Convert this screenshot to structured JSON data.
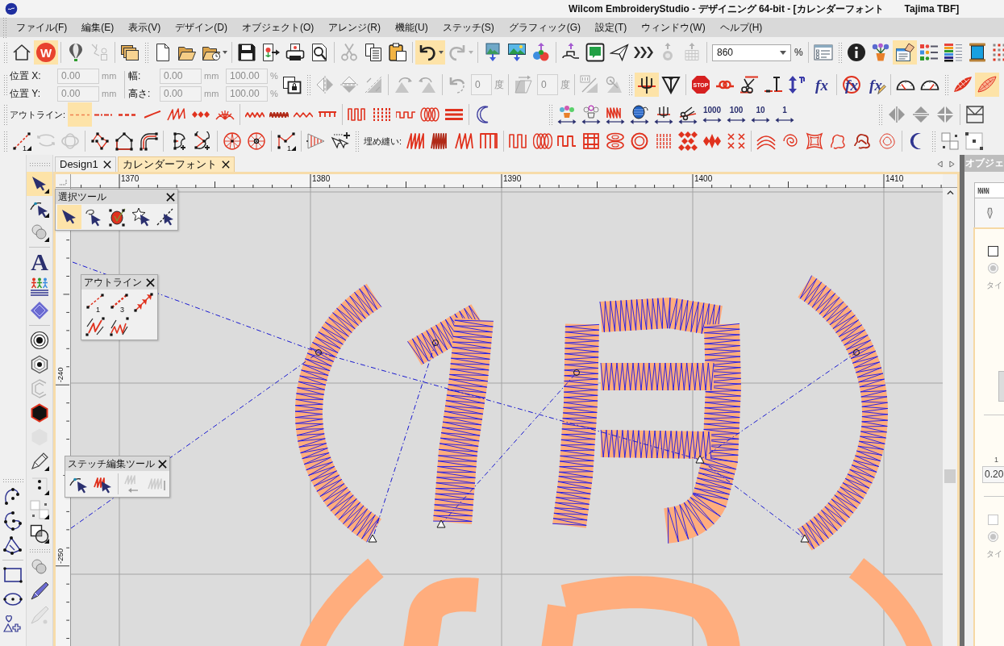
{
  "title_bar": {
    "title": "Wilcom EmbroideryStudio - デザイニング 64-bit - [カレンダーフォント",
    "format": "Tajima TBF]"
  },
  "menu_bar": [
    "ファイル(F)",
    "編集(E)",
    "表示(V)",
    "デザイン(D)",
    "オブジェクト(O)",
    "アレンジ(R)",
    "機能(U)",
    "ステッチ(S)",
    "グラフィック(G)",
    "設定(T)",
    "ウィンドウ(W)",
    "ヘルプ(H)"
  ],
  "standard_toolbar": {
    "buttons": [
      {
        "selected": false,
        "disabled": false
      },
      {
        "selected": true,
        "disabled": false,
        "label": "W"
      },
      {
        "selected": false,
        "disabled": false
      },
      {
        "selected": false,
        "disabled": true
      },
      {
        "selected": false,
        "disabled": false
      },
      {
        "selected": false,
        "disabled": false
      },
      {
        "selected": false,
        "disabled": false
      },
      {
        "selected": false,
        "disabled": false
      },
      {
        "selected": false,
        "disabled": false
      },
      {
        "selected": false,
        "disabled": false
      },
      {
        "selected": false,
        "disabled": false
      },
      {
        "selected": false,
        "disabled": false
      },
      {
        "selected": false,
        "disabled": true
      },
      {
        "selected": false,
        "disabled": false
      },
      {
        "selected": false,
        "disabled": false
      },
      {
        "selected": true,
        "disabled": false
      },
      {
        "selected": false,
        "disabled": true
      },
      {
        "selected": false,
        "disabled": false
      },
      {
        "selected": false,
        "disabled": false
      },
      {
        "selected": false,
        "disabled": false
      },
      {
        "selected": false,
        "disabled": false
      },
      {
        "selected": false,
        "disabled": false
      },
      {
        "selected": false,
        "disabled": false
      },
      {
        "selected": false,
        "disabled": false
      },
      {
        "selected": false,
        "disabled": true
      },
      {
        "selected": false,
        "disabled": true
      },
      {
        "selected": false,
        "disabled": false
      },
      {
        "selected": false,
        "disabled": false
      },
      {
        "selected": false,
        "disabled": false
      },
      {
        "selected": true,
        "disabled": false
      },
      {
        "selected": false,
        "disabled": false
      },
      {
        "selected": false,
        "disabled": false
      },
      {
        "selected": false,
        "disabled": false
      },
      {
        "selected": false,
        "disabled": false
      }
    ],
    "zoom": {
      "value": "860",
      "unit": "%"
    }
  },
  "transform_toolbar": {
    "position": [
      {
        "label": "位置 X:",
        "value": "0.00",
        "unit": "mm",
        "disabled": true
      },
      {
        "label": "位置 Y:",
        "value": "0.00",
        "unit": "mm",
        "disabled": true
      }
    ],
    "size": [
      {
        "label": "幅:",
        "value": "0.00",
        "unit": "mm",
        "scale": "100.00",
        "scale_unit": "%",
        "disabled": true
      },
      {
        "label": "高さ:",
        "value": "0.00",
        "unit": "mm",
        "scale": "100.00",
        "scale_unit": "%",
        "disabled": true
      }
    ],
    "buttons": [
      {
        "selected": false,
        "disabled": false
      },
      {
        "selected": false,
        "disabled": true
      },
      {
        "selected": false,
        "disabled": true
      },
      {
        "selected": false,
        "disabled": true
      },
      {
        "selected": false,
        "disabled": true
      },
      {
        "selected": false,
        "disabled": true
      },
      {
        "selected": false,
        "disabled": true
      },
      {
        "selected": false,
        "disabled": true
      },
      {
        "selected": false,
        "disabled": true
      },
      {
        "selected": false,
        "disabled": true
      },
      {
        "selected": true,
        "disabled": false
      },
      {
        "selected": false,
        "disabled": false
      },
      {
        "selected": false,
        "disabled": false,
        "label": "STOP"
      },
      {
        "selected": false,
        "disabled": false
      },
      {
        "selected": false,
        "disabled": false
      },
      {
        "selected": false,
        "disabled": false
      },
      {
        "selected": false,
        "disabled": false
      },
      {
        "selected": false,
        "disabled": false,
        "label": "fx"
      },
      {
        "selected": false,
        "disabled": false,
        "label": "fx"
      },
      {
        "selected": false,
        "disabled": false,
        "label": "fx"
      },
      {
        "selected": false,
        "disabled": false
      },
      {
        "selected": false,
        "disabled": false
      },
      {
        "selected": false,
        "disabled": false
      },
      {
        "selected": true,
        "disabled": false
      }
    ],
    "angle_fields": [
      {
        "value": "0",
        "unit": "度",
        "disabled": true
      },
      {
        "value": "0",
        "unit": "度",
        "disabled": true
      }
    ]
  },
  "outline_toolbar": {
    "label": "アウトライン:",
    "buttons": [
      {
        "selected": true,
        "disabled": false
      },
      {
        "selected": false,
        "disabled": false
      },
      {
        "selected": false,
        "disabled": false
      },
      {
        "selected": false,
        "disabled": false
      },
      {
        "selected": false,
        "disabled": false
      },
      {
        "selected": false,
        "disabled": false
      },
      {
        "selected": false,
        "disabled": false
      },
      {
        "selected": false,
        "disabled": false
      },
      {
        "selected": false,
        "disabled": false
      },
      {
        "selected": false,
        "disabled": false
      },
      {
        "selected": false,
        "disabled": false
      },
      {
        "selected": false,
        "disabled": false
      },
      {
        "selected": false,
        "disabled": false
      },
      {
        "selected": false,
        "disabled": false
      },
      {
        "selected": false,
        "disabled": false
      },
      {
        "selected": false,
        "disabled": false
      },
      {
        "selected": false,
        "disabled": false
      }
    ]
  },
  "stitch_toolbar": {
    "buttons": [
      {
        "selected": false,
        "disabled": false
      },
      {
        "selected": false,
        "disabled": false
      },
      {
        "selected": false,
        "disabled": false
      },
      {
        "selected": false,
        "disabled": false
      },
      {
        "selected": false,
        "disabled": false
      },
      {
        "selected": false,
        "disabled": false
      },
      {
        "selected": false,
        "disabled": false,
        "label": "1000"
      },
      {
        "selected": false,
        "disabled": false,
        "label": "100"
      },
      {
        "selected": false,
        "disabled": false,
        "label": "10"
      },
      {
        "selected": false,
        "disabled": false,
        "label": "1"
      }
    ]
  },
  "arrange_toolbar": {
    "buttons": [
      {
        "selected": false,
        "disabled": false
      },
      {
        "selected": false,
        "disabled": false
      },
      {
        "selected": false,
        "disabled": false
      },
      {
        "selected": false,
        "disabled": false
      }
    ]
  },
  "digitize_toolbar": {
    "buttons": [
      {
        "selected": false,
        "disabled": false,
        "label": "1"
      },
      {
        "selected": false,
        "disabled": true
      },
      {
        "selected": false,
        "disabled": true
      },
      {
        "selected": false,
        "disabled": false
      },
      {
        "selected": false,
        "disabled": false
      },
      {
        "selected": false,
        "disabled": false
      },
      {
        "selected": false,
        "disabled": false
      },
      {
        "selected": false,
        "disabled": false
      },
      {
        "selected": false,
        "disabled": false
      },
      {
        "selected": false,
        "disabled": false
      },
      {
        "selected": false,
        "disabled": false,
        "label": "1"
      },
      {
        "selected": false,
        "disabled": false
      },
      {
        "selected": false,
        "disabled": false
      }
    ]
  },
  "fill_toolbar": {
    "label": "埋め縫い:",
    "buttons": [
      {
        "selected": false,
        "disabled": false
      },
      {
        "selected": false,
        "disabled": false
      },
      {
        "selected": false,
        "disabled": false
      },
      {
        "selected": false,
        "disabled": false
      },
      {
        "selected": false,
        "disabled": false
      },
      {
        "selected": false,
        "disabled": false
      },
      {
        "selected": false,
        "disabled": false
      },
      {
        "selected": false,
        "disabled": false
      },
      {
        "selected": false,
        "disabled": false
      },
      {
        "selected": false,
        "disabled": false
      },
      {
        "selected": false,
        "disabled": false
      },
      {
        "selected": false,
        "disabled": false
      },
      {
        "selected": false,
        "disabled": false
      },
      {
        "selected": false,
        "disabled": false
      },
      {
        "selected": false,
        "disabled": false
      },
      {
        "selected": false,
        "disabled": false
      },
      {
        "selected": false,
        "disabled": false
      },
      {
        "selected": false,
        "disabled": false
      },
      {
        "selected": false,
        "disabled": false
      },
      {
        "selected": false,
        "disabled": false
      },
      {
        "selected": false,
        "disabled": false
      }
    ]
  },
  "view_toolbar": {
    "buttons": [
      {
        "selected": false,
        "disabled": false
      },
      {
        "selected": false,
        "disabled": false
      }
    ]
  },
  "toolbox": {
    "buttons": [
      {
        "selected": true,
        "disabled": false
      },
      {
        "selected": false,
        "disabled": false
      },
      {
        "selected": false,
        "disabled": false
      },
      {
        "selected": false,
        "disabled": false,
        "label": "A"
      },
      {
        "selected": false,
        "disabled": false
      },
      {
        "selected": false,
        "disabled": false
      },
      {
        "selected": false,
        "disabled": false
      },
      {
        "selected": false,
        "disabled": false
      },
      {
        "selected": false,
        "disabled": true
      },
      {
        "selected": false,
        "disabled": false
      },
      {
        "selected": false,
        "disabled": true
      },
      {
        "selected": false,
        "disabled": false
      },
      {
        "selected": false,
        "disabled": false
      },
      {
        "selected": false,
        "disabled": false
      },
      {
        "selected": false,
        "disabled": false
      },
      {
        "selected": false,
        "disabled": false
      },
      {
        "selected": false,
        "disabled": false
      },
      {
        "selected": false,
        "disabled": true
      }
    ]
  },
  "shape_toolbox": {
    "buttons": [
      {
        "selected": false,
        "disabled": false
      },
      {
        "selected": false,
        "disabled": false
      },
      {
        "selected": false,
        "disabled": false
      },
      {
        "selected": false,
        "disabled": false
      },
      {
        "selected": false,
        "disabled": false
      },
      {
        "selected": false,
        "disabled": false
      }
    ]
  },
  "tabs": [
    {
      "label": "Design1",
      "selected": false
    },
    {
      "label": "カレンダーフォント",
      "selected": true
    }
  ],
  "rulers": {
    "horizontal": [
      "1370",
      "1380",
      "1390",
      "1400",
      "1410"
    ],
    "vertical": [
      "-240",
      "-250"
    ]
  },
  "floating_toolbars": [
    {
      "title": "選択ツール",
      "buttons": [
        {
          "selected": true,
          "disabled": false
        },
        {
          "selected": false,
          "disabled": false
        },
        {
          "selected": false,
          "disabled": false
        },
        {
          "selected": false,
          "disabled": false
        },
        {
          "selected": false,
          "disabled": false
        }
      ]
    },
    {
      "title": "アウトライン",
      "buttons": [
        {
          "selected": false,
          "disabled": false,
          "label": "1"
        },
        {
          "selected": false,
          "disabled": false,
          "label": "3"
        },
        {
          "selected": false,
          "disabled": false
        },
        {
          "selected": false,
          "disabled": false
        },
        {
          "selected": false,
          "disabled": false
        }
      ]
    },
    {
      "title": "ステッチ編集ツール",
      "buttons": [
        {
          "selected": false,
          "disabled": false
        },
        {
          "selected": false,
          "disabled": false
        },
        {
          "selected": false,
          "disabled": true
        },
        {
          "selected": false,
          "disabled": true
        }
      ]
    }
  ],
  "object_panel": {
    "title": "オブジェ",
    "groups": [
      {
        "checked": false,
        "disabled": false,
        "option_selected": true,
        "type_label": "タイ"
      },
      {
        "checked": false,
        "disabled": true,
        "option_selected": true,
        "type_label": "タイ"
      }
    ],
    "scale_label": "1",
    "value": "0.20"
  }
}
